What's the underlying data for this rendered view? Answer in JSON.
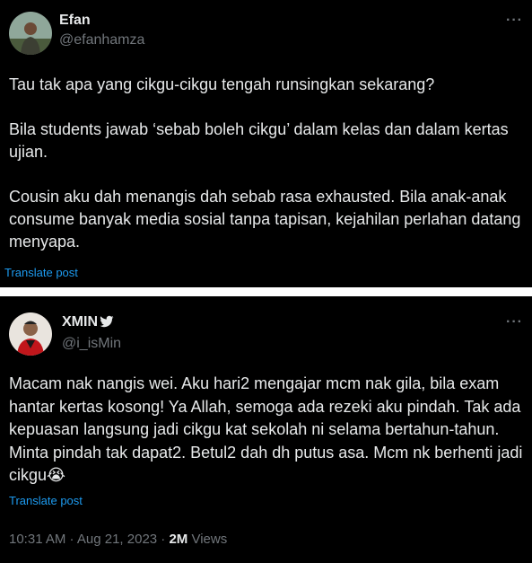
{
  "tweet1": {
    "display_name": "Efan",
    "handle": "@efanhamza",
    "more_label": "···",
    "paragraphs": [
      "Tau tak apa yang cikgu-cikgu tengah runsingkan sekarang?",
      "Bila students jawab ‘sebab boleh cikgu’ dalam kelas dan dalam kertas ujian.",
      "Cousin aku dah menangis dah sebab rasa exhausted. Bila anak-anak consume banyak media sosial tanpa tapisan, kejahilan perlahan datang menyapa."
    ],
    "translate_label": "Translate post"
  },
  "tweet2": {
    "display_name": "XMIN",
    "handle": "@i_isMin",
    "more_label": "···",
    "text": "Macam nak nangis wei. Aku hari2 mengajar mcm nak gila, bila exam hantar kertas kosong! Ya Allah, semoga ada rezeki aku pindah. Tak ada kepuasan langsung jadi cikgu kat sekolah ni selama bertahun-tahun. Minta pindah tak dapat2. Betul2 dah dh putus asa. Mcm nk berhenti jadi cikgu",
    "emoji": "😭",
    "translate_label": "Translate post",
    "timestamp": "10:31 AM · Aug 21, 2023 · ",
    "views_count": "2M",
    "views_label": " Views"
  },
  "colors": {
    "background": "#000000",
    "text": "#e7e9ea",
    "secondary": "#71767b",
    "link": "#1d9bf0"
  }
}
